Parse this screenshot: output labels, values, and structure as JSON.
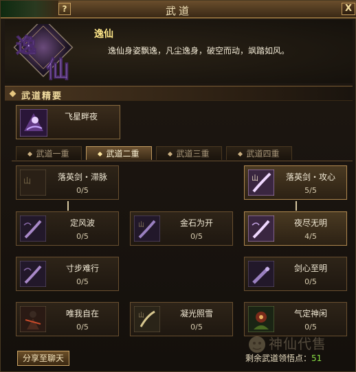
{
  "window": {
    "title": "武道",
    "help_label": "?",
    "close_label": "X"
  },
  "header": {
    "emblem_text": "逸仙",
    "name": "逸仙",
    "description": "逸仙身姿飘逸，凡尘逸身，破空而动，飒踏如风。"
  },
  "section": {
    "title": "武道精要"
  },
  "essence": {
    "label": "飞星畔夜",
    "icon": "ninja-star-night-icon"
  },
  "tabs": [
    {
      "label": "武道一重",
      "active": false
    },
    {
      "label": "武道二重",
      "active": true
    },
    {
      "label": "武道三重",
      "active": false
    },
    {
      "label": "武道四重",
      "active": false
    }
  ],
  "skills": {
    "luoying_zhimai": {
      "name": "落英剑・滞脉",
      "level": "0/5",
      "icon": "sword-slash-icon"
    },
    "luoying_gongxin": {
      "name": "落英剑・攻心",
      "level": "5/5",
      "icon": "sword-slash-icon"
    },
    "dingfeng": {
      "name": "定风波",
      "level": "0/5",
      "icon": "wind-blade-icon"
    },
    "jinshi": {
      "name": "金石为开",
      "level": "0/5",
      "icon": "stone-blade-icon"
    },
    "yejin": {
      "name": "夜尽无明",
      "level": "4/5",
      "icon": "night-blade-icon"
    },
    "cunbu": {
      "name": "寸步难行",
      "level": "0/5",
      "icon": "wind-blade-icon"
    },
    "jianxin": {
      "name": "剑心至明",
      "level": "0/5",
      "icon": "sword-heart-icon"
    },
    "weiwo": {
      "name": "唯我自在",
      "level": "0/5",
      "icon": "warrior-icon"
    },
    "ningguang": {
      "name": "凝光照雪",
      "level": "0/5",
      "icon": "light-snow-icon"
    },
    "qiding": {
      "name": "气定神闲",
      "level": "0/5",
      "icon": "calm-monk-icon"
    }
  },
  "footer": {
    "share_label": "分享至聊天",
    "points_label": "剩余武道领悟点：",
    "points_value": "51"
  },
  "watermark": {
    "text": "神仙代售",
    "icon": "mascot-icon"
  },
  "colors": {
    "accent_gold": "#f2dca0",
    "points_green": "#88dd44",
    "name_yellow": "#ffe88a"
  }
}
